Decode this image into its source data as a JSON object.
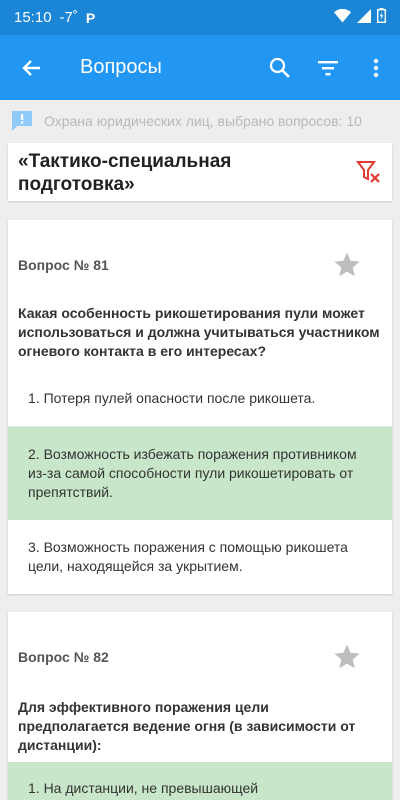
{
  "status": {
    "time": "15:10",
    "temperature": "-7˚",
    "badge": "P"
  },
  "appbar": {
    "title": "Вопросы",
    "icons": [
      "back-arrow-icon",
      "search-icon",
      "filter-icon",
      "more-vert-icon"
    ]
  },
  "info": {
    "text": "Охрана юридических лиц, выбрано вопросов: 10"
  },
  "section": {
    "title": "«Тактико-специальная подготовка»"
  },
  "questions": [
    {
      "number": "Вопрос № 81",
      "text": "Какая особенность рикошетирования пули может использоваться и должна учитываться участником огневого контакта в его интересах?",
      "answers": [
        {
          "text": "1. Потеря пулей опасности после рикошета.",
          "correct": false
        },
        {
          "text": "2. Возможность избежать поражения противником из-за самой способности пули рикошетировать от препятствий.",
          "correct": true
        },
        {
          "text": "3. Возможность поражения с помощью рикошета цели, находящейся за укрытием.",
          "correct": false
        }
      ]
    },
    {
      "number": "Вопрос № 82",
      "text": "Для эффективного поражения цели предполагается ведение огня (в зависимости от дистанции):",
      "answers": [
        {
          "text": "1. На дистанции, не превышающей",
          "correct": true
        }
      ]
    }
  ],
  "colors": {
    "primary": "#2196f3",
    "statusbar": "#1b86d6",
    "correct_bg": "#c8e6c9",
    "clear_filter": "#e53935"
  }
}
